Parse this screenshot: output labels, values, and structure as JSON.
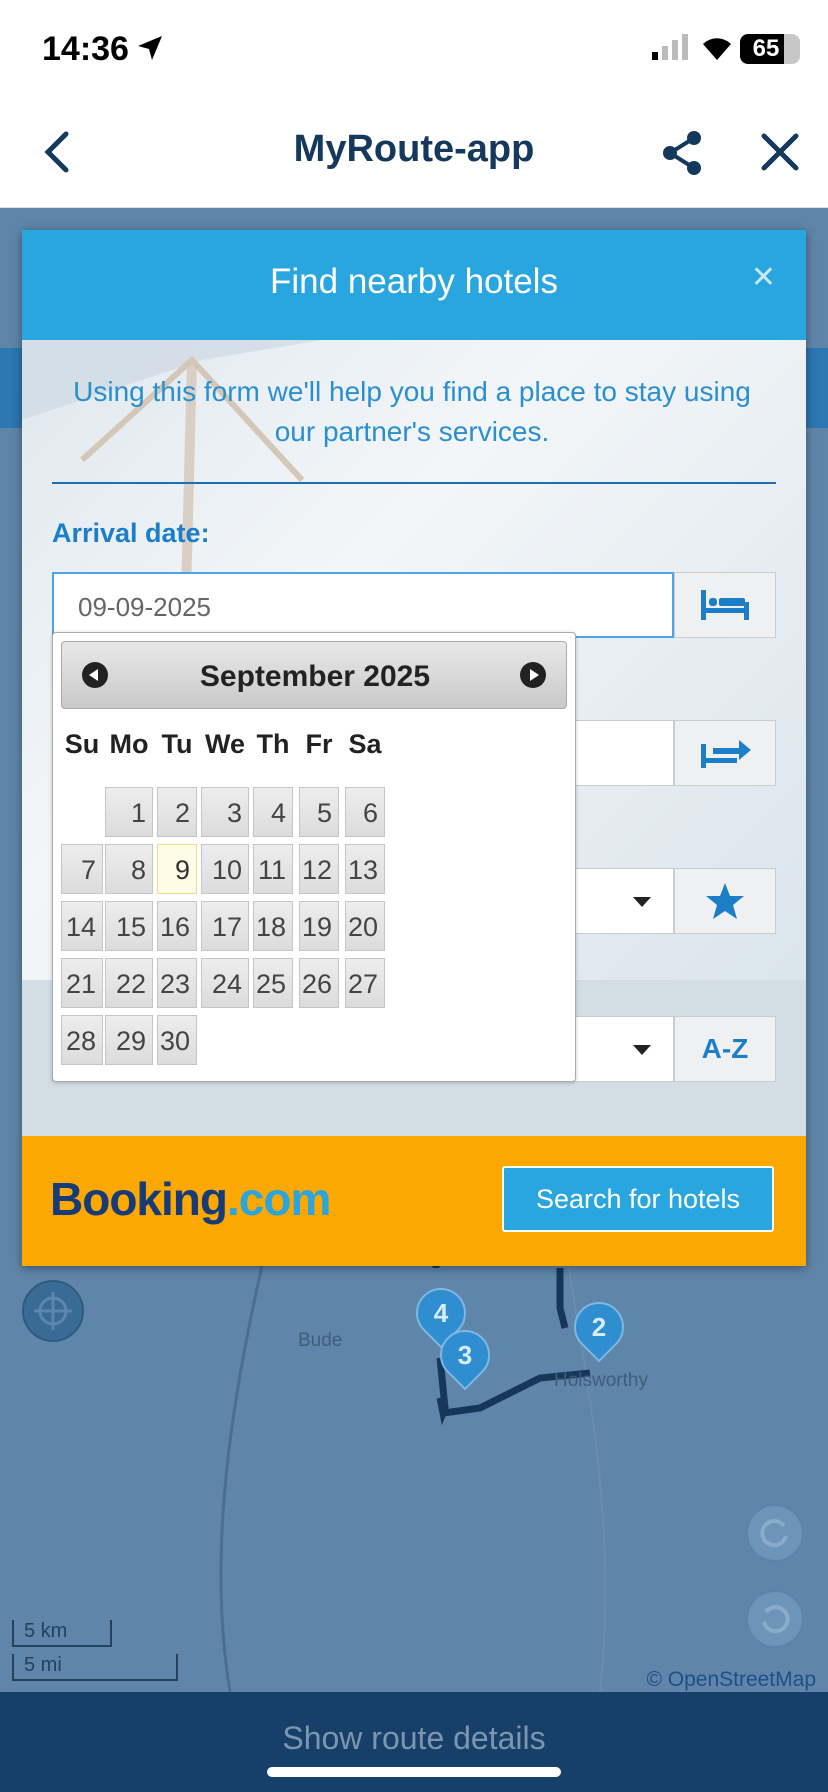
{
  "status_bar": {
    "time": "14:36",
    "battery": "65"
  },
  "header": {
    "title": "MyRoute-app"
  },
  "map": {
    "places": [
      "Bude",
      "Holsworthy"
    ],
    "markers": [
      "4",
      "3",
      "2"
    ],
    "scale_km": "5 km",
    "scale_mi": "5 mi",
    "attribution": "© OpenStreetMap"
  },
  "modal": {
    "title": "Find nearby hotels",
    "intro": "Using this form we'll help you find a place to stay using our partner's services.",
    "arrival_label": "Arrival date:",
    "arrival_value": "09-09-2025",
    "sort_button": "A-Z",
    "partner_logo": {
      "name": "Booking",
      "suffix": ".com"
    },
    "search_button": "Search for hotels"
  },
  "datepicker": {
    "month": "September 2025",
    "weekdays": [
      "Su",
      "Mo",
      "Tu",
      "We",
      "Th",
      "Fr",
      "Sa"
    ],
    "first_weekday_index": 1,
    "days_in_month": 30,
    "selected_day": 9
  },
  "bottom": {
    "label": "Show route details"
  },
  "colors": {
    "accent": "#29a6e0",
    "header_text": "#14395c",
    "booking_orange": "#fca800"
  }
}
